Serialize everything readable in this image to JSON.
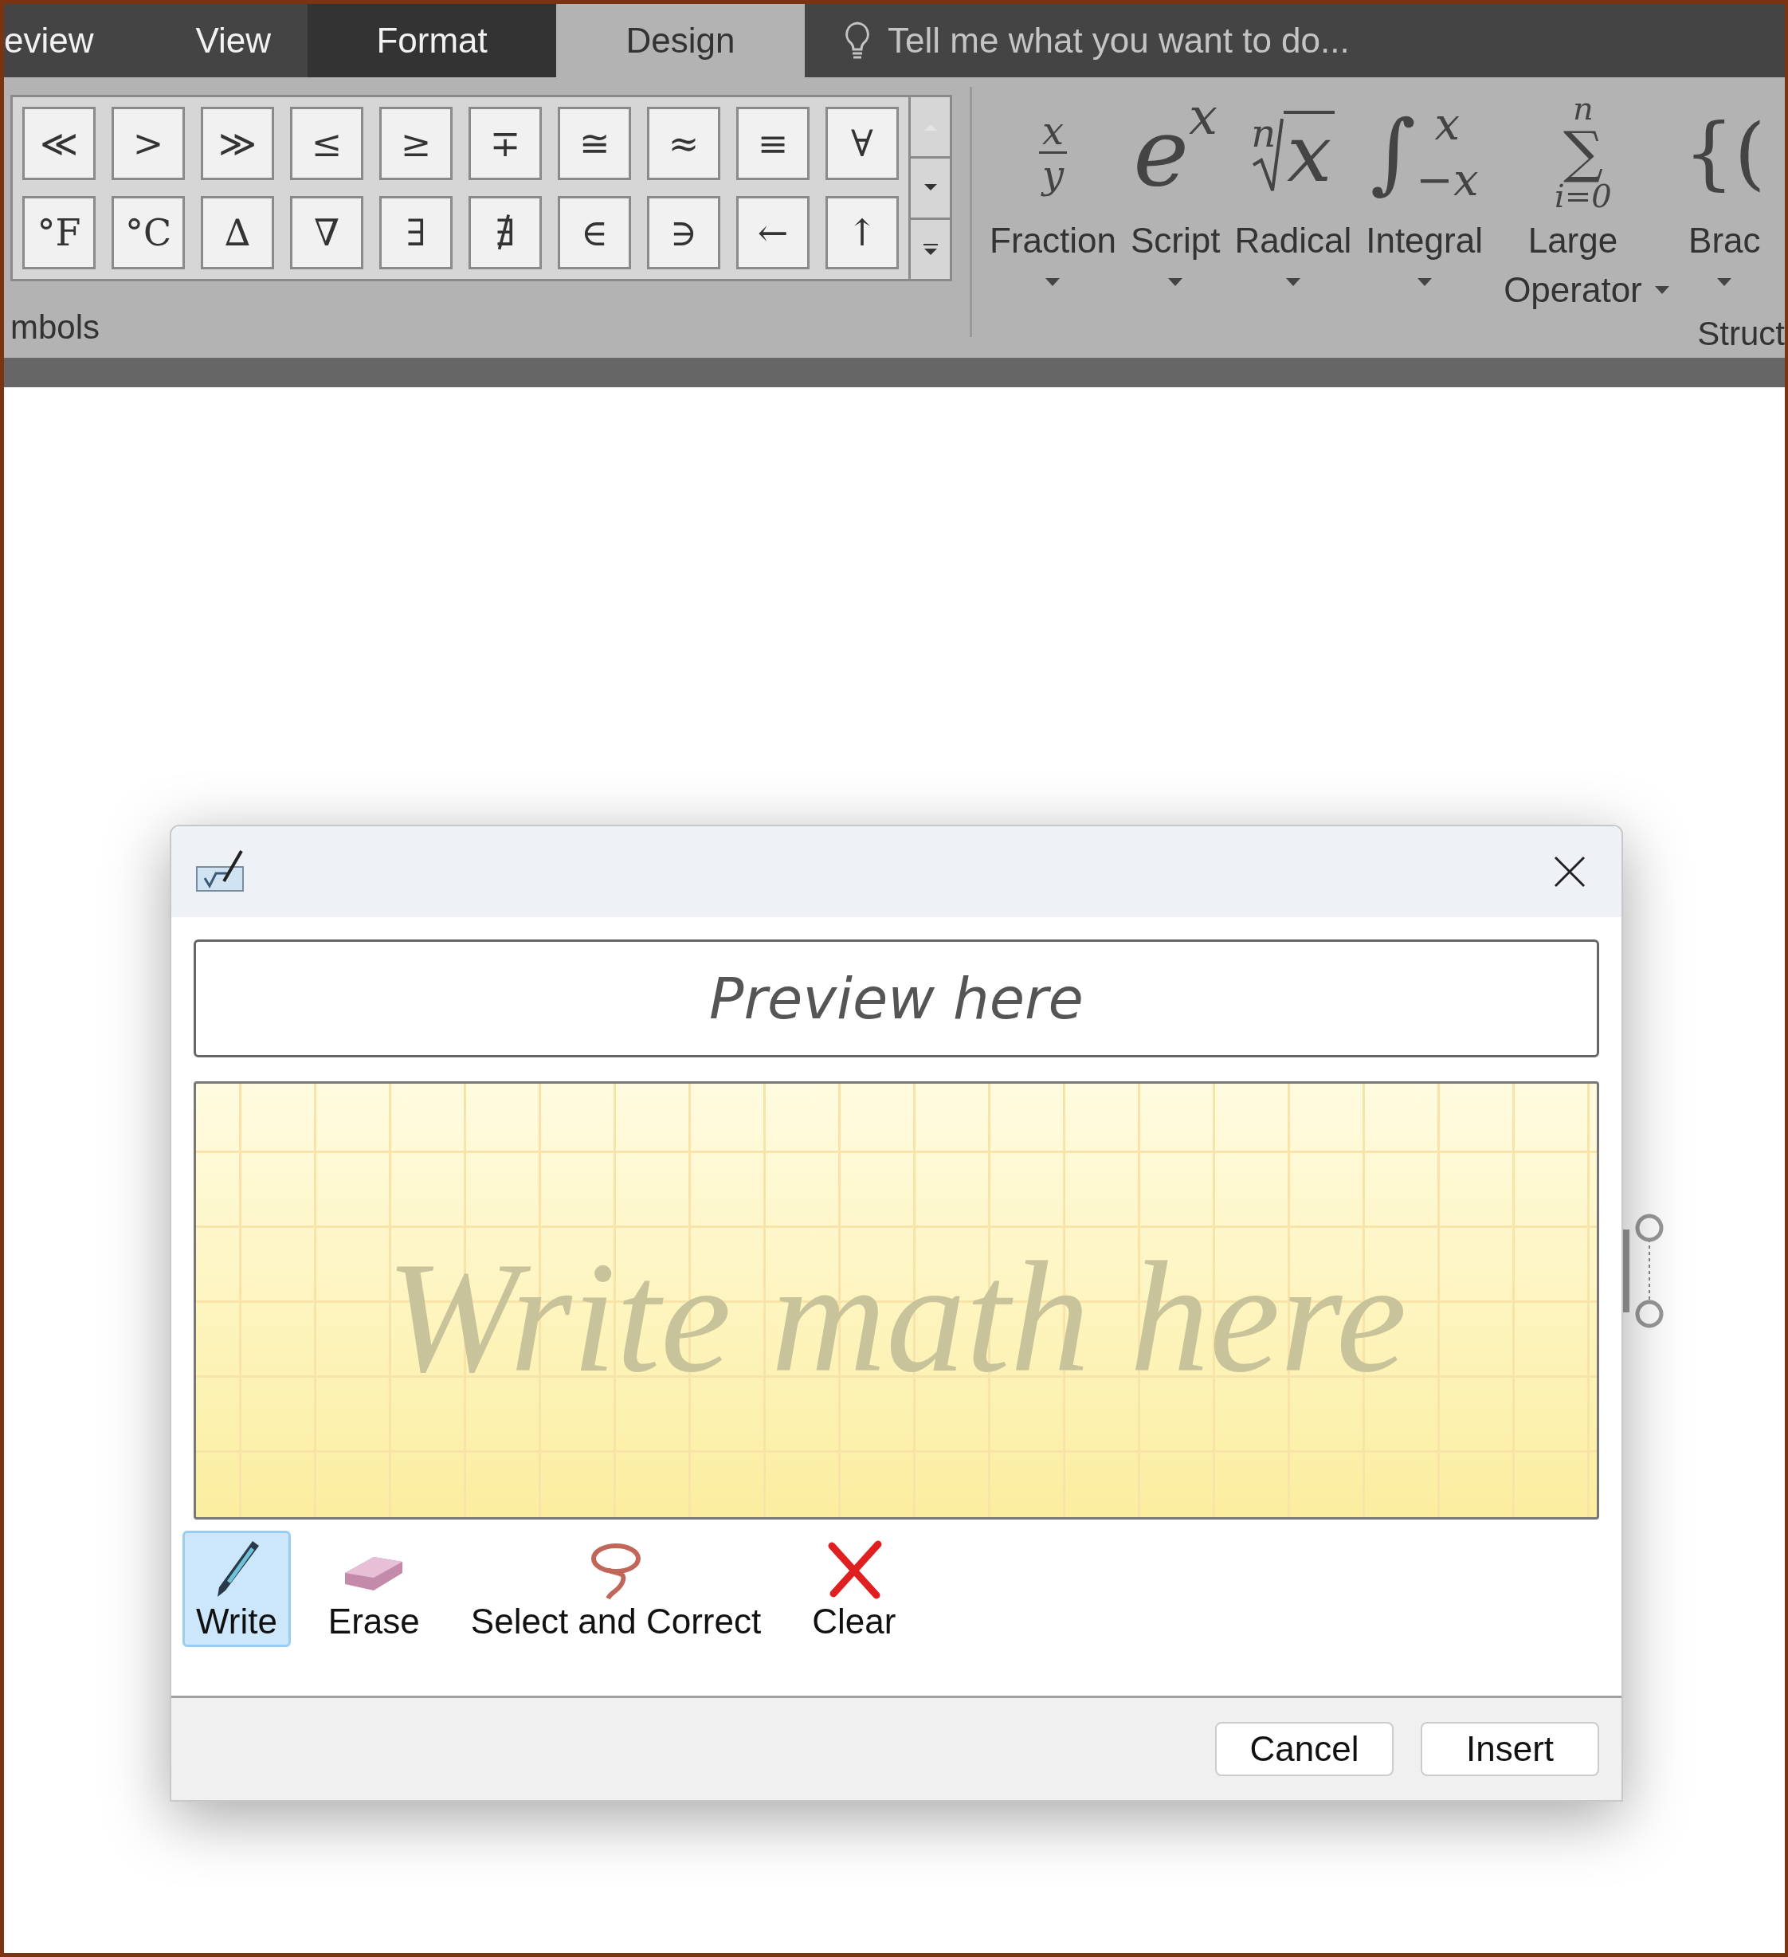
{
  "ribbon_tabs": [
    {
      "label": "eview",
      "kind": "normal",
      "selected": false
    },
    {
      "label": "View",
      "kind": "normal",
      "selected": false
    },
    {
      "label": "Format",
      "kind": "contextual",
      "selected": false
    },
    {
      "label": "Design",
      "kind": "contextual",
      "selected": true
    }
  ],
  "tell_me": {
    "placeholder": "Tell me what you want to do..."
  },
  "symbols": {
    "group_label": "mbols",
    "items": [
      "≪",
      ">",
      "≫",
      "≤",
      "≥",
      "∓",
      "≅",
      "≈",
      "≡",
      "∀",
      "°F",
      "°C",
      "∆",
      "∇",
      "∃",
      "∄",
      "∈",
      "∋",
      "←",
      "↑"
    ]
  },
  "structures": {
    "group_label": "Struct",
    "items": [
      {
        "kind": "fraction",
        "label": "Fraction",
        "parts": [
          "x",
          "y"
        ]
      },
      {
        "kind": "script",
        "label": "Script",
        "parts": [
          "e",
          "x"
        ]
      },
      {
        "kind": "radical",
        "label": "Radical",
        "parts": [
          "n",
          "x"
        ]
      },
      {
        "kind": "integral",
        "label": "Integral",
        "parts": [
          "∫",
          "x",
          "−x"
        ]
      },
      {
        "kind": "large_operator",
        "label": "Large Operator",
        "parts": [
          "n",
          "∑",
          "i=0"
        ]
      },
      {
        "kind": "bracket",
        "label": "Brac",
        "parts": [
          "{("
        ]
      }
    ]
  },
  "dialog": {
    "preview": {
      "placeholder": "Preview here"
    },
    "canvas": {
      "placeholder": "Write math here"
    },
    "tools": [
      {
        "kind": "write",
        "label": "Write",
        "selected": true
      },
      {
        "kind": "erase",
        "label": "Erase",
        "selected": false
      },
      {
        "kind": "select",
        "label": "Select and Correct",
        "selected": false
      },
      {
        "kind": "clear",
        "label": "Clear",
        "selected": false
      }
    ],
    "buttons": [
      "Cancel",
      "Insert"
    ]
  }
}
